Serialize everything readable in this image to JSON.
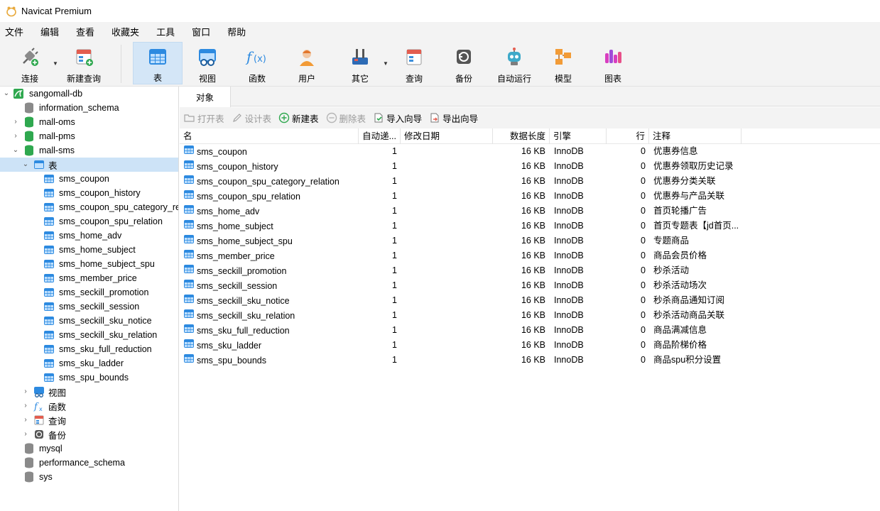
{
  "window": {
    "title": "Navicat Premium"
  },
  "menu": [
    "文件",
    "编辑",
    "查看",
    "收藏夹",
    "工具",
    "窗口",
    "帮助"
  ],
  "toolbar": {
    "connect": "连接",
    "new_query": "新建查询",
    "table": "表",
    "view": "视图",
    "function": "函数",
    "user": "用户",
    "other": "其它",
    "query": "查询",
    "backup": "备份",
    "automation": "自动运行",
    "model": "模型",
    "chart": "图表"
  },
  "tree": {
    "connection": "sangomall-db",
    "databases": [
      "information_schema",
      "mall-oms",
      "mall-pms",
      "mall-sms"
    ],
    "tables_node": "表",
    "tables": [
      "sms_coupon",
      "sms_coupon_history",
      "sms_coupon_spu_category_re",
      "sms_coupon_spu_relation",
      "sms_home_adv",
      "sms_home_subject",
      "sms_home_subject_spu",
      "sms_member_price",
      "sms_seckill_promotion",
      "sms_seckill_session",
      "sms_seckill_sku_notice",
      "sms_seckill_sku_relation",
      "sms_sku_full_reduction",
      "sms_sku_ladder",
      "sms_spu_bounds"
    ],
    "other_nodes": [
      "视图",
      "函数",
      "查询",
      "备份"
    ],
    "other_databases": [
      "mysql",
      "performance_schema",
      "sys"
    ]
  },
  "main": {
    "tab": "对象",
    "actions": {
      "open_table": "打开表",
      "design_table": "设计表",
      "new_table": "新建表",
      "delete_table": "删除表",
      "import_wizard": "导入向导",
      "export_wizard": "导出向导"
    },
    "columns": {
      "name": "名",
      "auto_inc": "自动递...",
      "modified": "修改日期",
      "data_length": "数据长度",
      "engine": "引擎",
      "rows": "行",
      "comment": "注释"
    },
    "rows": [
      {
        "name": "sms_coupon",
        "auto_inc": "1",
        "data_length": "16 KB",
        "engine": "InnoDB",
        "rows": "0",
        "comment": "优惠券信息"
      },
      {
        "name": "sms_coupon_history",
        "auto_inc": "1",
        "data_length": "16 KB",
        "engine": "InnoDB",
        "rows": "0",
        "comment": "优惠券领取历史记录"
      },
      {
        "name": "sms_coupon_spu_category_relation",
        "auto_inc": "1",
        "data_length": "16 KB",
        "engine": "InnoDB",
        "rows": "0",
        "comment": "优惠券分类关联"
      },
      {
        "name": "sms_coupon_spu_relation",
        "auto_inc": "1",
        "data_length": "16 KB",
        "engine": "InnoDB",
        "rows": "0",
        "comment": "优惠券与产品关联"
      },
      {
        "name": "sms_home_adv",
        "auto_inc": "1",
        "data_length": "16 KB",
        "engine": "InnoDB",
        "rows": "0",
        "comment": "首页轮播广告"
      },
      {
        "name": "sms_home_subject",
        "auto_inc": "1",
        "data_length": "16 KB",
        "engine": "InnoDB",
        "rows": "0",
        "comment": "首页专题表【jd首页..."
      },
      {
        "name": "sms_home_subject_spu",
        "auto_inc": "1",
        "data_length": "16 KB",
        "engine": "InnoDB",
        "rows": "0",
        "comment": "专题商品"
      },
      {
        "name": "sms_member_price",
        "auto_inc": "1",
        "data_length": "16 KB",
        "engine": "InnoDB",
        "rows": "0",
        "comment": "商品会员价格"
      },
      {
        "name": "sms_seckill_promotion",
        "auto_inc": "1",
        "data_length": "16 KB",
        "engine": "InnoDB",
        "rows": "0",
        "comment": "秒杀活动"
      },
      {
        "name": "sms_seckill_session",
        "auto_inc": "1",
        "data_length": "16 KB",
        "engine": "InnoDB",
        "rows": "0",
        "comment": "秒杀活动场次"
      },
      {
        "name": "sms_seckill_sku_notice",
        "auto_inc": "1",
        "data_length": "16 KB",
        "engine": "InnoDB",
        "rows": "0",
        "comment": "秒杀商品通知订阅"
      },
      {
        "name": "sms_seckill_sku_relation",
        "auto_inc": "1",
        "data_length": "16 KB",
        "engine": "InnoDB",
        "rows": "0",
        "comment": "秒杀活动商品关联"
      },
      {
        "name": "sms_sku_full_reduction",
        "auto_inc": "1",
        "data_length": "16 KB",
        "engine": "InnoDB",
        "rows": "0",
        "comment": "商品满减信息"
      },
      {
        "name": "sms_sku_ladder",
        "auto_inc": "1",
        "data_length": "16 KB",
        "engine": "InnoDB",
        "rows": "0",
        "comment": "商品阶梯价格"
      },
      {
        "name": "sms_spu_bounds",
        "auto_inc": "1",
        "data_length": "16 KB",
        "engine": "InnoDB",
        "rows": "0",
        "comment": "商品spu积分设置"
      }
    ]
  },
  "colors": {
    "selection": "#cde3f7",
    "active_tool": "#d4e6f7",
    "db_green": "#2fa84f"
  }
}
